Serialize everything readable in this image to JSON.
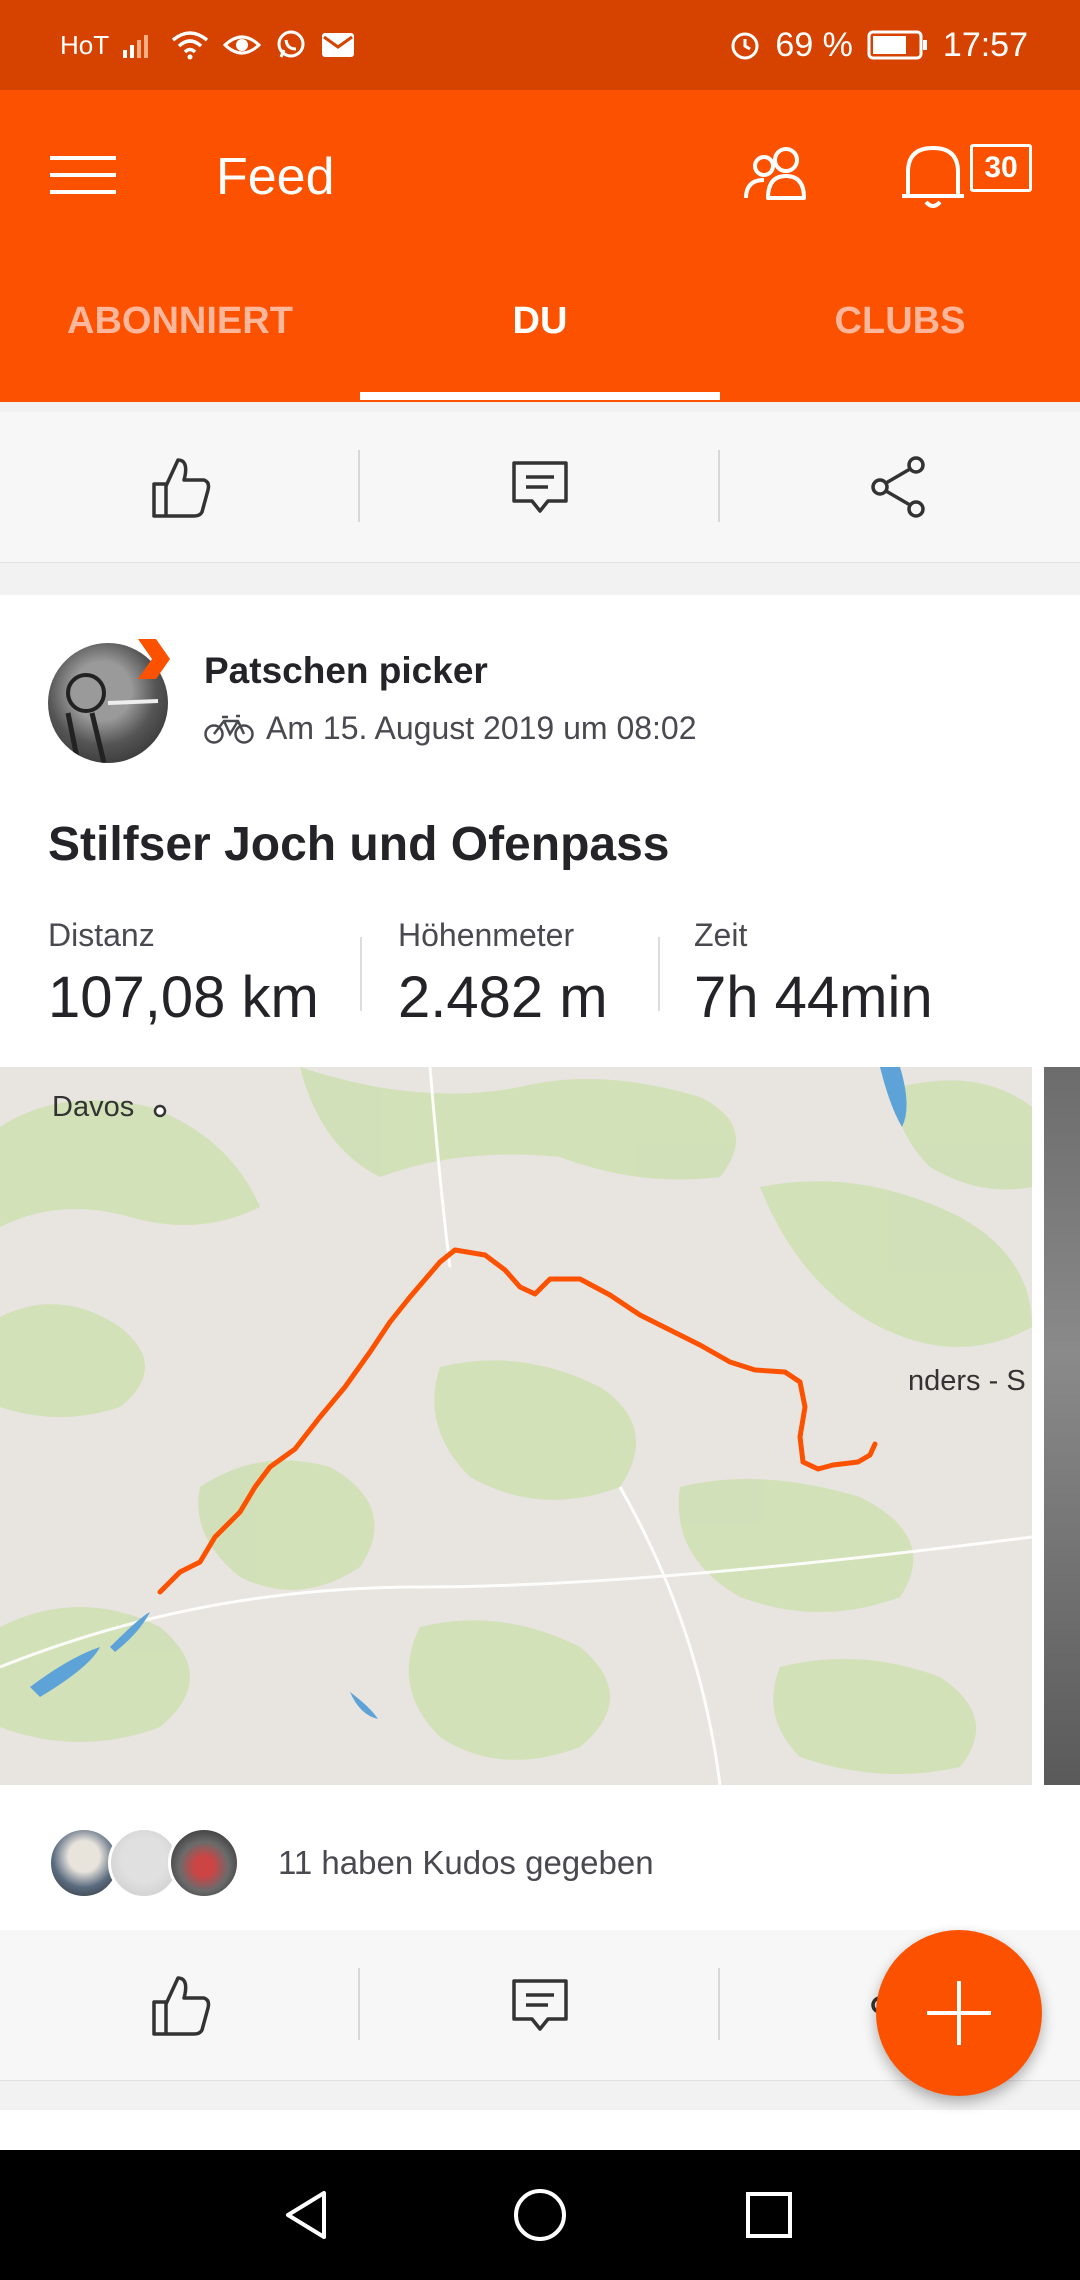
{
  "status_bar": {
    "carrier": "HoT",
    "battery_percent": "69 %",
    "time": "17:57"
  },
  "app_bar": {
    "title": "Feed",
    "notification_count": "30"
  },
  "tabs": [
    {
      "label": "ABONNIERT",
      "active": false
    },
    {
      "label": "DU",
      "active": true
    },
    {
      "label": "CLUBS",
      "active": false
    }
  ],
  "activity": {
    "athlete": "Patschen picker",
    "date": "Am 15. August 2019 um 08:02",
    "title": "Stilfser Joch und Ofenpass",
    "stats": [
      {
        "label": "Distanz",
        "value": "107,08 km"
      },
      {
        "label": "Höhenmeter",
        "value": "2.482 m"
      },
      {
        "label": "Zeit",
        "value": "7h 44min"
      }
    ],
    "map": {
      "labels": [
        "Davos",
        "nders - S"
      ]
    },
    "kudos_text": "11 haben Kudos gegeben"
  },
  "colors": {
    "brand": "#fc5200",
    "status_bar": "#d64300",
    "route": "#fc5200"
  }
}
